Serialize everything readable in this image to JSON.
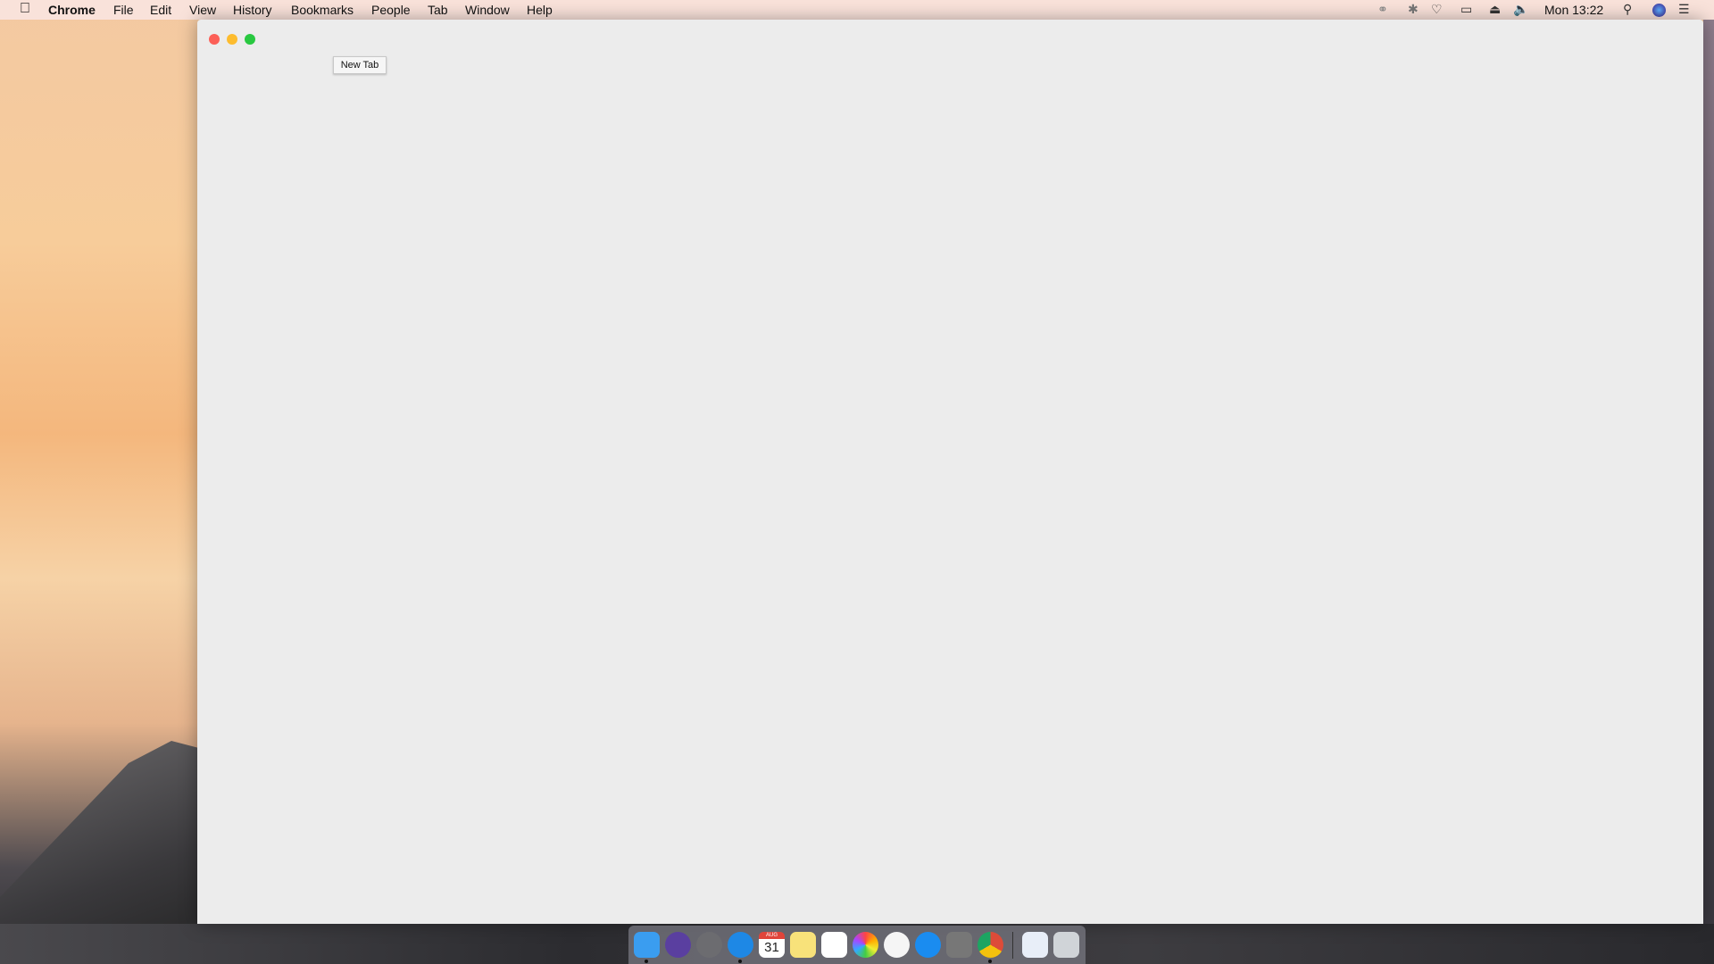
{
  "menubar": {
    "app_name": "Chrome",
    "items": [
      "File",
      "Edit",
      "View",
      "History",
      "Bookmarks",
      "People",
      "Tab",
      "Window",
      "Help"
    ],
    "clock": "Mon 13:22",
    "status_icons": [
      "creative-cloud-icon",
      "bluetooth-icon",
      "wifi-icon",
      "airplay-icon",
      "eject-icon",
      "volume-icon",
      "spotlight-icon",
      "siri-icon",
      "notification-center-icon"
    ]
  },
  "window": {
    "tooltip": "New Tab",
    "traffic_colors": {
      "close": "#fc5f57",
      "minimize": "#fdbc2e",
      "zoom": "#28c840"
    }
  },
  "dock": {
    "apps": [
      {
        "name": "finder",
        "color": "#3a9df0",
        "running": true
      },
      {
        "name": "siri",
        "color": "#5a3fa0",
        "running": false
      },
      {
        "name": "launchpad",
        "color": "#6c6c70",
        "running": false
      },
      {
        "name": "safari",
        "color": "#1e88e5",
        "running": true
      },
      {
        "name": "calendar",
        "color": "#ffffff",
        "running": false,
        "month": "AUG",
        "day": "31"
      },
      {
        "name": "notes",
        "color": "#f8e27a",
        "running": false
      },
      {
        "name": "reminders",
        "color": "#ffffff",
        "running": false
      },
      {
        "name": "photos",
        "color": "#f3f3f3",
        "running": false
      },
      {
        "name": "itunes",
        "color": "#f5f5f5",
        "running": false
      },
      {
        "name": "app-store",
        "color": "#1a8cf0",
        "running": false
      },
      {
        "name": "system-preferences",
        "color": "#777777",
        "running": false
      },
      {
        "name": "chrome",
        "color": "#dd4b39",
        "running": true
      }
    ],
    "extras": [
      {
        "name": "safari-window-thumbnail",
        "color": "#e8eef8"
      },
      {
        "name": "trash",
        "color": "#d0d4d8"
      }
    ]
  }
}
